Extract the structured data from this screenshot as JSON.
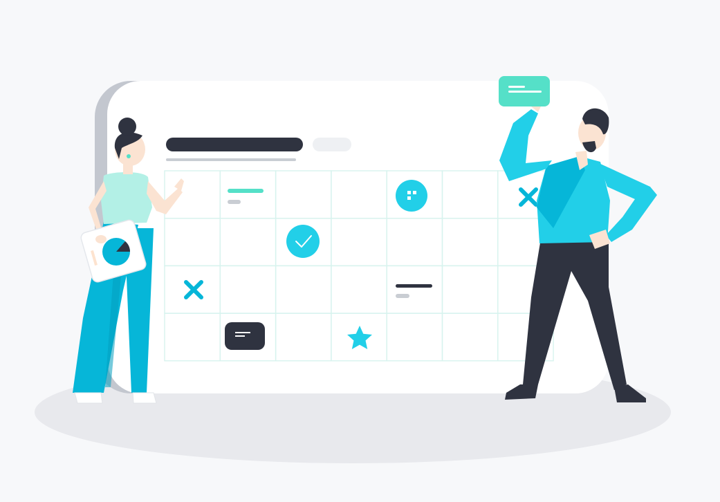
{
  "scene": {
    "kind": "calendar-planning-illustration",
    "colors": {
      "background": "#f7f8fa",
      "floor": "#e8e9ed",
      "board": "#ffffff",
      "board_shadow": "#c3c7cf",
      "grid_line": "#d7f3ee",
      "navy": "#2f3340",
      "cyan": "#06b6d8",
      "cyan_light": "#22cfe8",
      "mint": "#55e0c8",
      "mint_pale": "#b3f0e6",
      "gray_bar": "#c9cdd3",
      "skin": "#fbe3d2"
    }
  },
  "calendar": {
    "rows": 4,
    "columns": 7,
    "cells": [
      {
        "row": 0,
        "col": 1,
        "icon": "event-lines"
      },
      {
        "row": 0,
        "col": 4,
        "icon": "dots-badge"
      },
      {
        "row": 0,
        "col": 6,
        "icon": "x-mark"
      },
      {
        "row": 1,
        "col": 2,
        "icon": "check-circle"
      },
      {
        "row": 2,
        "col": 0,
        "icon": "x-mark"
      },
      {
        "row": 2,
        "col": 4,
        "icon": "event-lines-dark"
      },
      {
        "row": 3,
        "col": 1,
        "icon": "message-chip"
      },
      {
        "row": 3,
        "col": 3,
        "icon": "star"
      }
    ]
  },
  "figures": [
    {
      "name": "woman-with-chart",
      "holds": "pie-chart-card"
    },
    {
      "name": "man-with-note",
      "holds": "sticky-note"
    }
  ]
}
